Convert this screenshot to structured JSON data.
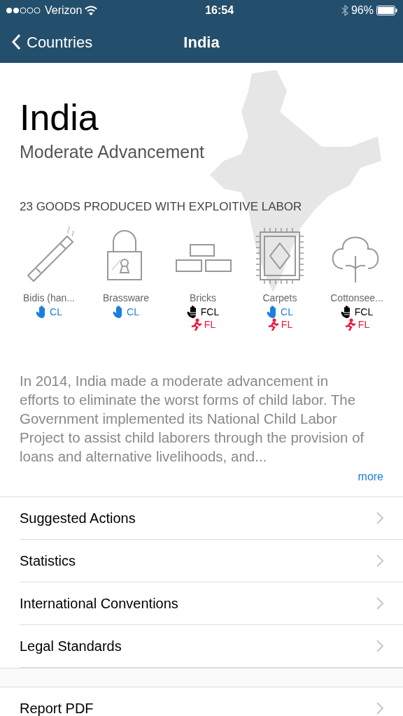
{
  "status_bar": {
    "carrier": "Verizon",
    "time": "16:54",
    "battery": "96%"
  },
  "nav": {
    "back": "Countries",
    "title": "India"
  },
  "country": {
    "name": "India",
    "assessment": "Moderate Advancement"
  },
  "goods_heading": "23 GOODS PRODUCED WITH EXPLOITIVE LABOR",
  "goods": [
    {
      "name": "Bidis (han...",
      "kind": "cigarette",
      "tags": [
        {
          "kind": "cl",
          "label": "CL"
        }
      ]
    },
    {
      "name": "Brassware",
      "kind": "padlock",
      "tags": [
        {
          "kind": "cl",
          "label": "CL"
        }
      ]
    },
    {
      "name": "Bricks",
      "kind": "bricks",
      "tags": [
        {
          "kind": "fcl",
          "label": "FCL"
        },
        {
          "kind": "fl",
          "label": "FL"
        }
      ]
    },
    {
      "name": "Carpets",
      "kind": "carpet",
      "tags": [
        {
          "kind": "cl",
          "label": "CL"
        },
        {
          "kind": "fl",
          "label": "FL"
        }
      ]
    },
    {
      "name": "Cottonsee...",
      "kind": "cotton",
      "tags": [
        {
          "kind": "fcl",
          "label": "FCL"
        },
        {
          "kind": "fl",
          "label": "FL"
        }
      ]
    }
  ],
  "summary": "In 2014, India made a moderate advancement in efforts to eliminate the worst forms of child labor. The Government implemented its National Child Labor Project to assist child laborers through the provision of loans and alternative livelihoods, and...",
  "more": "more",
  "sections": [
    "Suggested Actions",
    "Statistics",
    "International Conventions",
    "Legal Standards"
  ],
  "extra_sections": [
    "Report PDF"
  ]
}
